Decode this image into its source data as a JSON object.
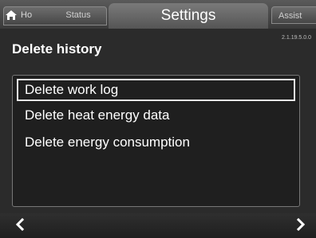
{
  "topbar": {
    "home_label": "Ho",
    "status_label": "Status",
    "settings_label": "Settings",
    "assist_label": "Assist"
  },
  "header": {
    "title": "Delete history",
    "version": "2.1.19.5.0.0"
  },
  "menu": {
    "items": [
      {
        "label": "Delete work log",
        "selected": true
      },
      {
        "label": "Delete heat energy data",
        "selected": false
      },
      {
        "label": "Delete energy consumption",
        "selected": false
      }
    ]
  },
  "nav": {
    "prev_icon": "chevron-left-icon",
    "next_icon": "chevron-right-icon"
  },
  "colors": {
    "background": "#2b2b2b",
    "panel": "#1f1f1f",
    "text": "#ffffff",
    "selection_border": "#e6e6e6"
  }
}
